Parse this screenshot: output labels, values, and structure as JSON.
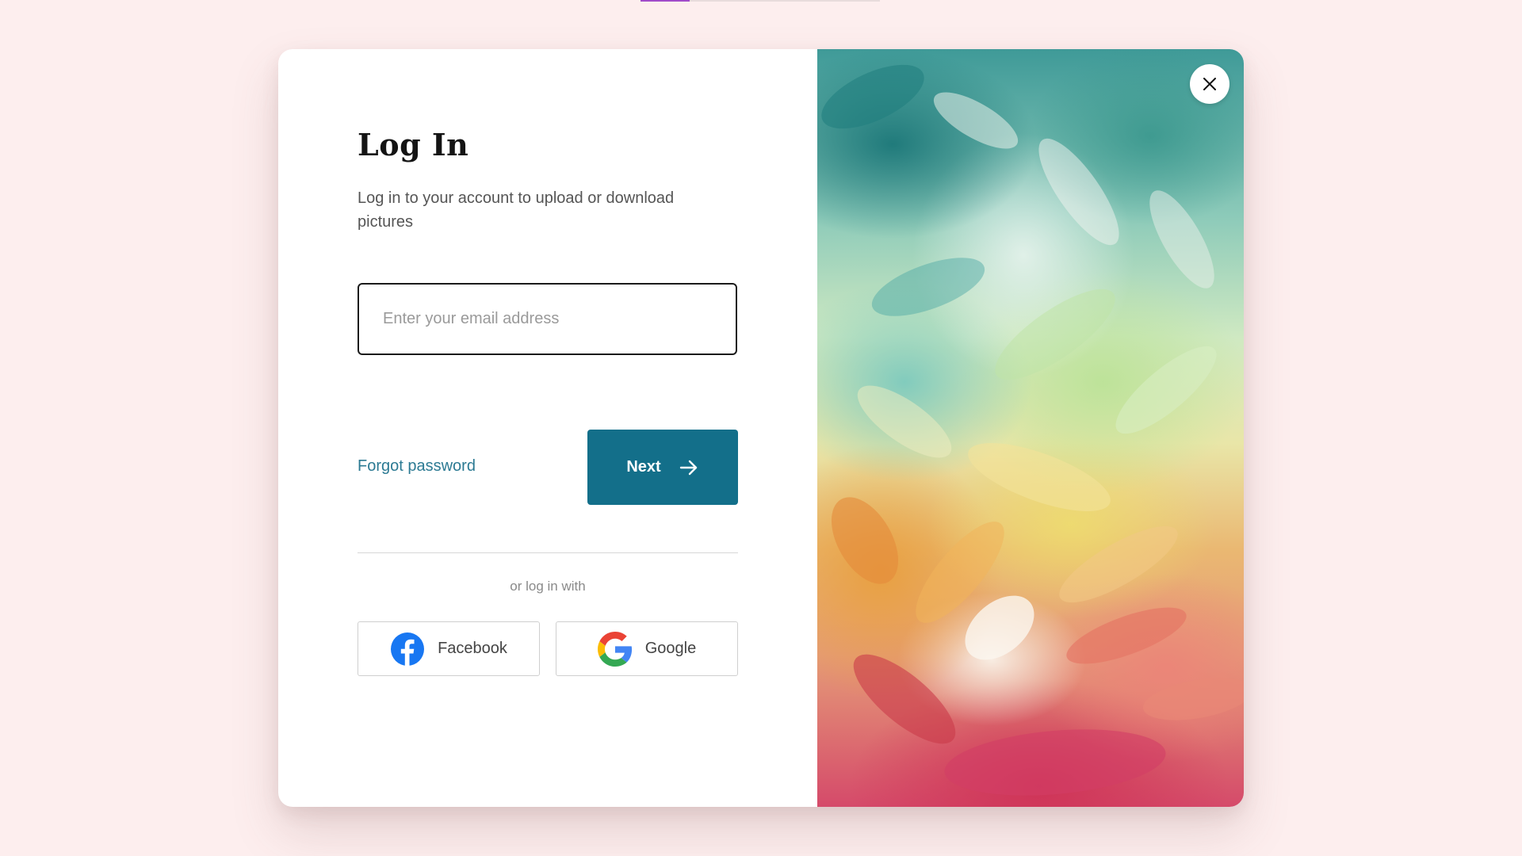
{
  "page": {
    "background_color": "#fdeeee"
  },
  "login": {
    "title": "Log In",
    "subtitle": "Log in to your account to upload or download pictures",
    "email_placeholder": "Enter your email address",
    "forgot_password": "Forgot password",
    "next_label": "Next",
    "next_icon": "arrow-right-icon",
    "alt_login_text": "or log in with",
    "social": [
      {
        "label": "Facebook",
        "icon": "facebook-icon"
      },
      {
        "label": "Google",
        "icon": "google-icon"
      }
    ]
  },
  "artwork": {
    "close_icon": "close-icon"
  },
  "colors": {
    "accent": "#136f8a",
    "link": "#2c7a93",
    "progress_active": "#a14bc9"
  }
}
